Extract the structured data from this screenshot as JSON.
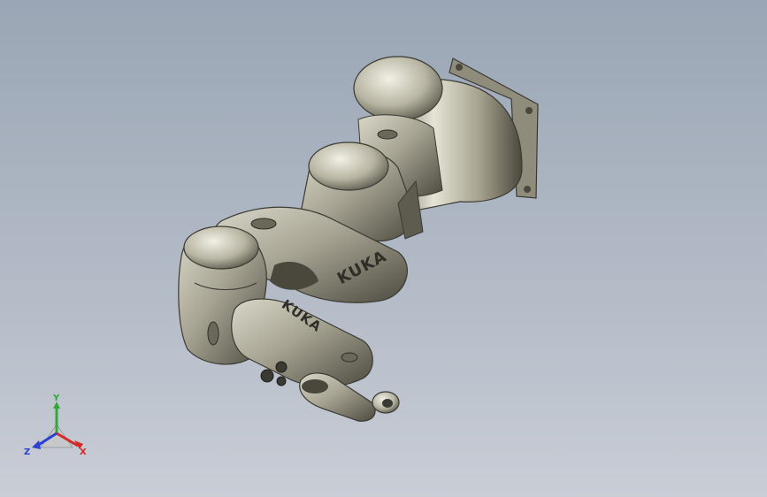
{
  "viewport": {
    "background_top": "#9aa6b5",
    "background_bottom": "#c9cdd6"
  },
  "model": {
    "branding": [
      "KUKA",
      "KUKA"
    ],
    "body_color": "#a7a493",
    "shadow_color": "#3f3e35",
    "highlight_color": "#e9e7da"
  },
  "triad": {
    "x_label": "X",
    "y_label": "Y",
    "z_label": "Z",
    "x_color": "#d42a2a",
    "y_color": "#2faa3a",
    "z_color": "#2a3fd4"
  }
}
